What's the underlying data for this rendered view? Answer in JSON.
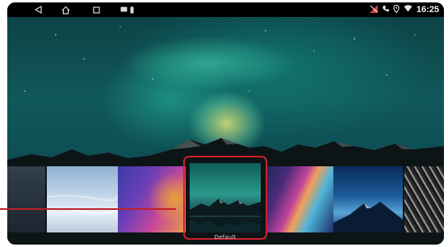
{
  "status_bar": {
    "nav_icons": [
      "back-icon",
      "home-icon",
      "recents-icon"
    ],
    "notification_icons": [
      "message-icon",
      "battery-icon"
    ],
    "right_icons": [
      "signal-off-icon",
      "phone-icon",
      "location-icon",
      "wifi-icon"
    ],
    "time": "16:25"
  },
  "wallpaper": {
    "current": "aurora-over-mountains",
    "thumbnails": [
      {
        "name": "dark-mountain"
      },
      {
        "name": "sky-clouds"
      },
      {
        "name": "purple-gradient"
      },
      {
        "name": "aurora-mountains",
        "selected": true
      },
      {
        "name": "colorful-waves"
      },
      {
        "name": "night-mountain"
      },
      {
        "name": "abstract-stripes"
      }
    ],
    "selected_label": "Default"
  },
  "colors": {
    "highlight": "#d0202a"
  }
}
